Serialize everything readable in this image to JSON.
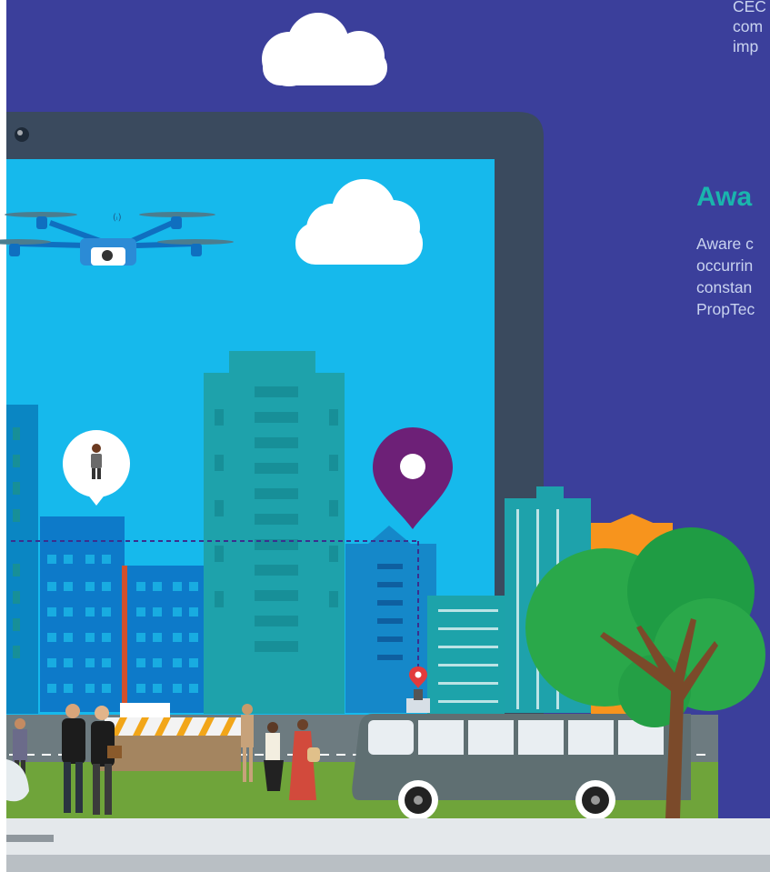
{
  "colors": {
    "background": "#3b3f9b",
    "tablet_frame": "#3a4a5e",
    "sky": "#16b9ec",
    "heading": "#1ab5ad",
    "body_text": "#c9d3ef",
    "map_pin": "#6d2077",
    "tree": "#2aa84a",
    "bus": "#5f6f72"
  },
  "text_intro": {
    "line1": "CEC",
    "line2": "com",
    "line3": "imp"
  },
  "section": {
    "heading": "Awa",
    "line1": "Aware c",
    "line2": "occurrin",
    "line3": "constan",
    "line4": "PropTec"
  }
}
